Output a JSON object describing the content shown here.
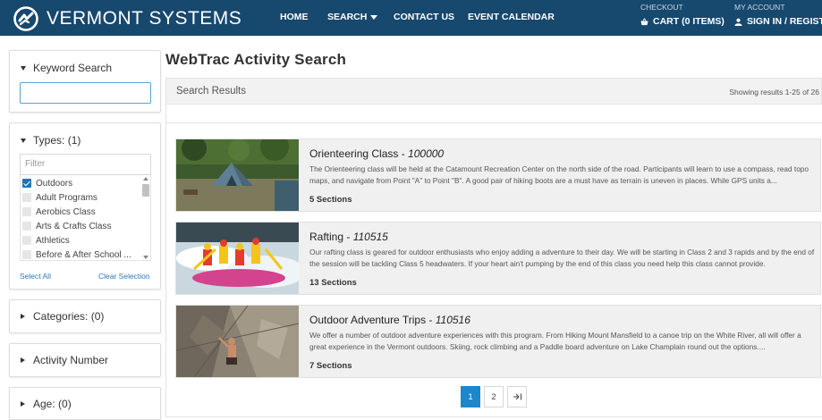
{
  "header": {
    "brand": "VERMONT SYSTEMS",
    "nav": [
      {
        "label": "HOME"
      },
      {
        "label": "SEARCH"
      },
      {
        "label": "CONTACT US"
      },
      {
        "label": "EVENT CALENDAR"
      }
    ],
    "checkout_label": "CHECKOUT",
    "cart_label": "CART (0 ITEMS)",
    "account_label": "MY ACCOUNT",
    "signin_label": "SIGN IN / REGISTER",
    "colors": {
      "bar": "#17486e"
    }
  },
  "sidebar": {
    "keyword": {
      "title": "Keyword Search",
      "value": ""
    },
    "types": {
      "title": "Types:",
      "count": "(1)",
      "filter_placeholder": "Filter",
      "items": [
        {
          "label": "Outdoors",
          "checked": true
        },
        {
          "label": "Adult Programs",
          "checked": false
        },
        {
          "label": "Aerobics Class",
          "checked": false
        },
        {
          "label": "Arts & Crafts Class",
          "checked": false
        },
        {
          "label": "Athletics",
          "checked": false
        },
        {
          "label": "Before & After School ...",
          "checked": false
        }
      ],
      "select_all": "Select All",
      "clear_selection": "Clear Selection"
    },
    "categories": {
      "title": "Categories:",
      "count": "(0)"
    },
    "activity_number": {
      "title": "Activity Number"
    },
    "age": {
      "title": "Age:",
      "count": "(0)"
    }
  },
  "main": {
    "title": "WebTrac Activity Search",
    "results_label": "Search Results",
    "results_count": "Showing results 1-25 of 26",
    "cards": [
      {
        "name": "Orienteering Class",
        "code": "100000",
        "description": "The Orienteering class will be held at the Catamount Recreation Center on the north side of the road. Participants will learn to use a compass, read topo maps, and navigate from Point \"A\" to Point \"B\". A good pair of hiking boots are a must have as terrain is uneven in places. While GPS units a...",
        "sections": "5 Sections",
        "image": "camping-tent-photo"
      },
      {
        "name": "Rafting",
        "code": "110515",
        "description": "Our rafting class is geared for outdoor enthusiasts who enjoy adding a adventure to their day. We will be starting in Class 2 and 3 rapids and by the end of the session will be tackling Class 5 headwaters. If your heart ain't pumping by the end of this class you need help this class cannot provide.",
        "sections": "13 Sections",
        "image": "whitewater-rafting-photo"
      },
      {
        "name": "Outdoor Adventure Trips",
        "code": "110516",
        "description": "We offer a number of outdoor adventure experiences with this program. From Hiking Mount Mansfield to a canoe trip on the White River, all will offer a great experience in the Vermont outdoors. Skiing, rock climbing and a Paddle board adventure on Lake Champlain round out the options....",
        "sections": "7 Sections",
        "image": "rock-climbing-photo"
      }
    ],
    "pagination": {
      "pages": [
        "1",
        "2"
      ],
      "current": "1",
      "last_icon": "last-page-icon"
    }
  }
}
